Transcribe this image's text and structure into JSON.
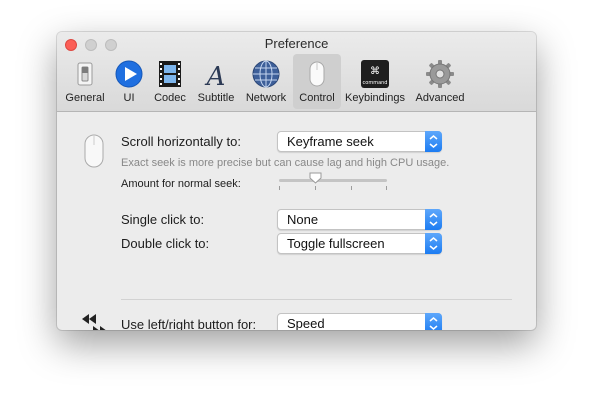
{
  "window": {
    "title": "Preference"
  },
  "toolbar": {
    "items": [
      {
        "label": "General",
        "icon": "switch-icon"
      },
      {
        "label": "UI",
        "icon": "play-icon"
      },
      {
        "label": "Codec",
        "icon": "film-icon"
      },
      {
        "label": "Subtitle",
        "icon": "letter-a-icon"
      },
      {
        "label": "Network",
        "icon": "globe-icon"
      },
      {
        "label": "Control",
        "icon": "mouse-icon"
      },
      {
        "label": "Keybindings",
        "icon": "command-key-icon"
      },
      {
        "label": "Advanced",
        "icon": "gear-icon"
      }
    ],
    "selected": "Control",
    "command_key_text": "command"
  },
  "control": {
    "scroll_label": "Scroll horizontally to:",
    "scroll_value": "Keyframe seek",
    "scroll_hint": "Exact seek is more precise but can cause lag and high CPU usage.",
    "amount_label": "Amount for normal seek:",
    "amount_level": 0.33,
    "single_click_label": "Single click to:",
    "single_click_value": "None",
    "double_click_label": "Double click to:",
    "double_click_value": "Toggle fullscreen",
    "button_label": "Use left/right button for:",
    "button_value": "Speed"
  },
  "colors": {
    "accent": "#1c7cf2",
    "close": "#fc5f57"
  }
}
